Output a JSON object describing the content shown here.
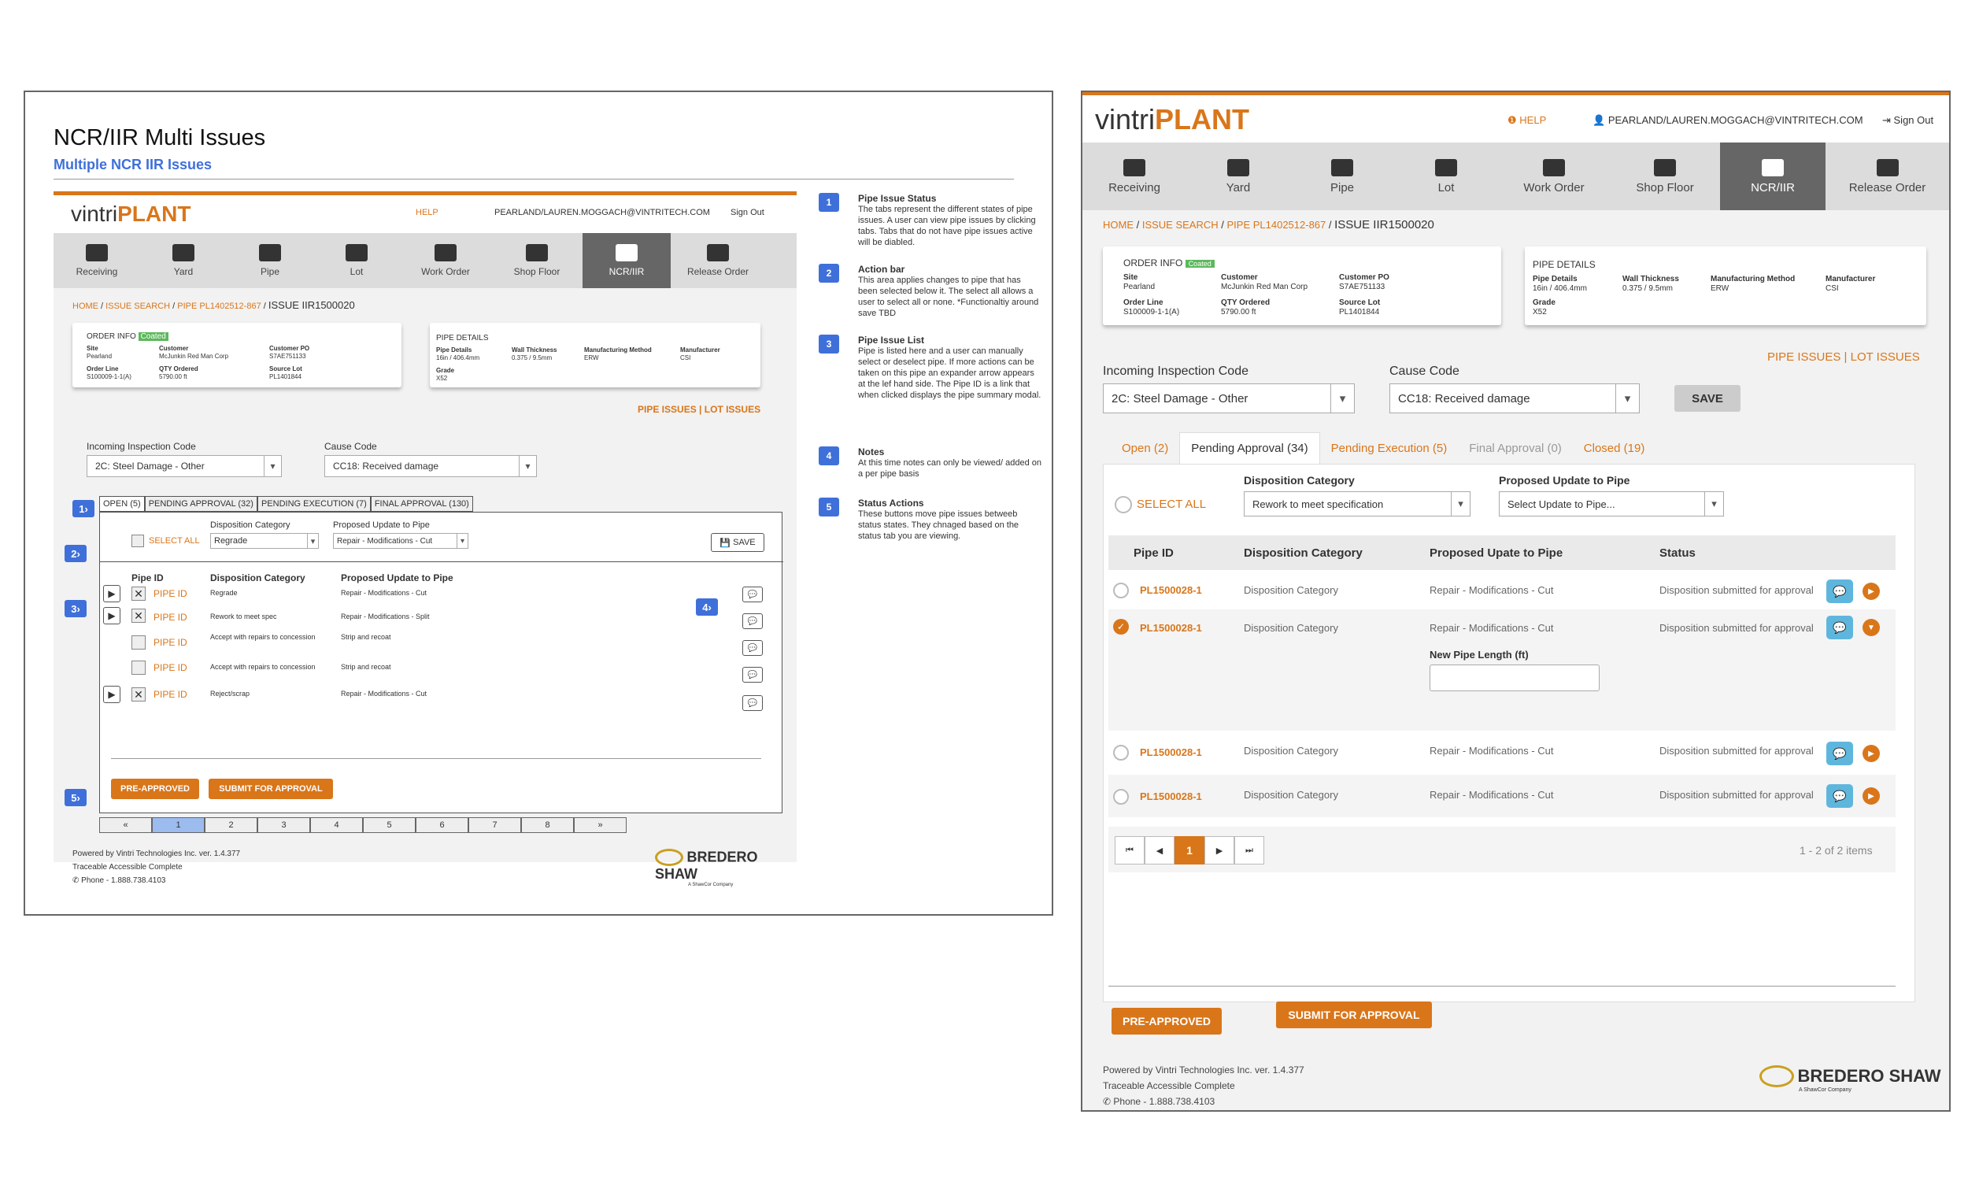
{
  "wireframe": {
    "title": "NCR/IIR Multi Issues",
    "subtitle": "Multiple NCR IIR Issues",
    "brand": {
      "prefix": "vintri",
      "name": "PLANT"
    },
    "help": "HELP",
    "user": "PEARLAND/LAUREN.MOGGACH@VINTRITECH.COM",
    "signout": "Sign Out",
    "nav": [
      "Receiving",
      "Yard",
      "Pipe",
      "Lot",
      "Work Order",
      "Shop Floor",
      "NCR/IIR",
      "Release Order"
    ],
    "breadcrumb": [
      "HOME",
      "ISSUE SEARCH",
      "PIPE PL1402512-867",
      "ISSUE IIR1500020"
    ],
    "order": {
      "title": "ORDER INFO",
      "badge": "Coated",
      "site_label": "Site",
      "site": "Pearland",
      "customer_label": "Customer",
      "customer": "McJunkin Red Man Corp",
      "po_label": "Customer PO",
      "po": "S7AE751133",
      "line_label": "Order Line",
      "line": "S100009-1-1(A)",
      "qty_label": "QTY Ordered",
      "qty": "5790.00 ft",
      "lot_label": "Source Lot",
      "lot": "PL1401844"
    },
    "pipe": {
      "title": "PIPE DETAILS",
      "details_label": "Pipe Details",
      "details": "16in / 406.4mm",
      "wall_label": "Wall Thickness",
      "wall": "0.375 / 9.5mm",
      "method_label": "Manufacturing Method",
      "method": "ERW",
      "mfr_label": "Manufacturer",
      "mfr": "CSI",
      "grade_label": "Grade",
      "grade": "X52"
    },
    "links": {
      "pipe_issues": "PIPE ISSUES",
      "lot_issues": "LOT ISSUES"
    },
    "inspection_label": "Incoming Inspection Code",
    "inspection": "2C: Steel Damage - Other",
    "cause_label": "Cause Code",
    "cause": "CC18: Received damage",
    "tabs": [
      "OPEN (5)",
      "PENDING APPROVAL (32)",
      "PENDING EXECUTION (7)",
      "FINAL APPROVAL (130)"
    ],
    "select_all": "SELECT ALL",
    "disp_label": "Disposition Category",
    "disp": "Regrade",
    "update_label": "Proposed Update to Pipe",
    "update": "Repair - Modifications - Cut",
    "save": "SAVE",
    "cols": [
      "Pipe ID",
      "Disposition Category",
      "Proposed Update to Pipe"
    ],
    "rows": [
      {
        "id": "PIPE ID",
        "disp": "Regrade",
        "upd": "Repair - Modifications - Cut"
      },
      {
        "id": "PIPE ID",
        "disp": "Rework to meet spec",
        "upd": "Repair - Modifications - Split"
      },
      {
        "id": "PIPE ID",
        "disp": "Accept with repairs to concession",
        "upd": "Strip and recoat"
      },
      {
        "id": "PIPE ID",
        "disp": "Accept with repairs to concession",
        "upd": "Strip and recoat"
      },
      {
        "id": "PIPE ID",
        "disp": "Reject/scrap",
        "upd": "Repair - Modifications - Cut"
      }
    ],
    "pre_approved": "PRE-APPROVED",
    "submit": "SUBMIT FOR APPROVAL",
    "pages": [
      "«",
      "1",
      "2",
      "3",
      "4",
      "5",
      "6",
      "7",
      "8",
      "»"
    ],
    "footer": [
      "Powered by Vintri Technologies Inc. ver. 1.4.377",
      "Traceable Accessible Complete",
      "Phone - 1.888.738.4103"
    ],
    "logo": {
      "name": "BREDERO SHAW",
      "tag": "A ShawCor Company"
    },
    "badges": [
      "1",
      "2",
      "3",
      "4",
      "5"
    ],
    "notes": [
      {
        "n": "1",
        "title": "Pipe Issue Status",
        "text": "The tabs represent the different states of pipe issues. A user can view pipe issues by clicking tabs. Tabs that do not have pipe issues active will be diabled."
      },
      {
        "n": "2",
        "title": "Action bar",
        "text": "This area applies changes to pipe that has been selected below it. The select all allows a user to select all or none. *Functionaltiy around save TBD"
      },
      {
        "n": "3",
        "title": "Pipe Issue List",
        "text": "Pipe is listed here and a user can manually select or deselect pipe. If more actions can be taken on this pipe an expander arrow appears at the lef hand side. The Pipe ID is a link that when clicked displays the pipe summary modal."
      },
      {
        "n": "4",
        "title": "Notes",
        "text": "At this time notes can only be viewed/ added on a per pipe basis"
      },
      {
        "n": "5",
        "title": "Status Actions",
        "text": "These buttons move pipe issues betweeb status states. They chnaged based on the status tab you are viewing."
      }
    ]
  },
  "design": {
    "tabs": [
      "Open (2)",
      "Pending Approval (34)",
      "Pending Execution (5)",
      "Final Approval (0)",
      "Closed (19)"
    ],
    "select_all": "SELECT ALL",
    "disp_label": "Disposition Category",
    "disp": "Rework to meet specification",
    "update_label": "Proposed Update to Pipe",
    "update": "Select Update to Pipe...",
    "cols": [
      "Pipe ID",
      "Disposition Category",
      "Proposed Upate to Pipe",
      "Status"
    ],
    "rows": [
      {
        "id": "PL1500028-1",
        "disp": "Disposition Category",
        "upd": "Repair - Modifications - Cut",
        "status": "Disposition submitted for approval"
      },
      {
        "id": "PL1500028-1",
        "disp": "Disposition Category",
        "upd": "Repair - Modifications - Cut",
        "status": "Disposition submitted for approval"
      },
      {
        "id": "PL1500028-1",
        "disp": "Disposition Category",
        "upd": "Repair - Modifications - Cut",
        "status": "Disposition submitted for approval"
      },
      {
        "id": "PL1500028-1",
        "disp": "Disposition Category",
        "upd": "Repair - Modifications - Cut",
        "status": "Disposition submitted for approval"
      }
    ],
    "new_length_label": "New Pipe Length (ft)",
    "pager": [
      "⏮",
      "◀",
      "1",
      "▶",
      "⏭"
    ],
    "items": "1 - 2 of 2 items"
  }
}
